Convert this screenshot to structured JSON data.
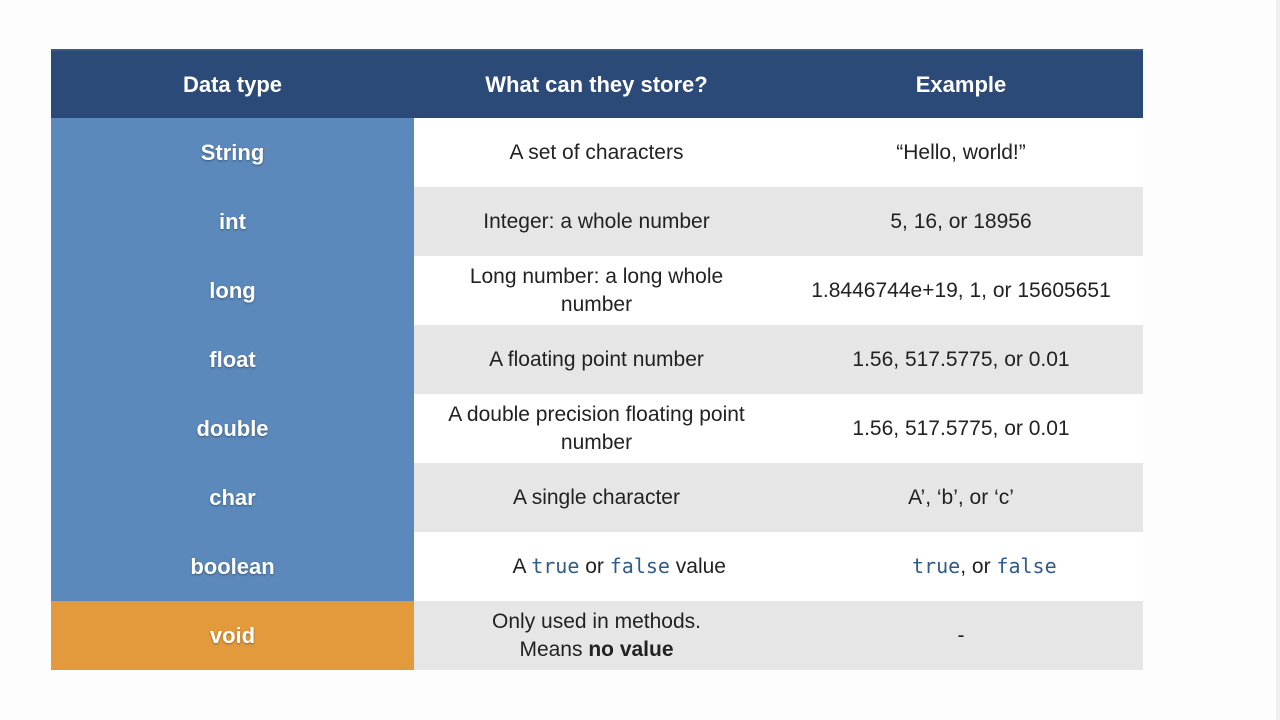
{
  "header": {
    "col1": "Data type",
    "col2": "What can they store?",
    "col3": "Example"
  },
  "rows": [
    {
      "type": "String",
      "store": "A set of characters",
      "example": "“Hello, world!”"
    },
    {
      "type": "int",
      "store": "Integer: a whole number",
      "example": "5, 16,  or 18956"
    },
    {
      "type": "long",
      "store_line1": "Long number: a long whole",
      "store_line2": "number",
      "example": "1.8446744e+19, 1, or 15605651"
    },
    {
      "type": "float",
      "store": "A floating point number",
      "example": "1.56, 517.5775, or 0.01"
    },
    {
      "type": "double",
      "store_line1": "A double precision floating point",
      "store_line2": "number",
      "example": "1.56, 517.5775, or 0.01"
    },
    {
      "type": "char",
      "store": "A single character",
      "example": "A’, ‘b’, or ‘c’"
    },
    {
      "type": "boolean",
      "store_prefix": "A ",
      "store_code1": "true",
      "store_mid": " or ",
      "store_code2": "false",
      "store_suffix": " value",
      "example_code1": "true",
      "example_mid": ", or ",
      "example_code2": "false"
    },
    {
      "type": "void",
      "store_line1": "Only used in methods.",
      "store_line2_prefix": "Means ",
      "store_line2_bold": "no value",
      "example": "-"
    }
  ],
  "colors": {
    "header_bg": "#2c4a77",
    "type_bg": "#5b89bb",
    "void_bg": "#e39a3c",
    "row_grey": "#e6e6e6",
    "code_text": "#2f5b8a"
  }
}
